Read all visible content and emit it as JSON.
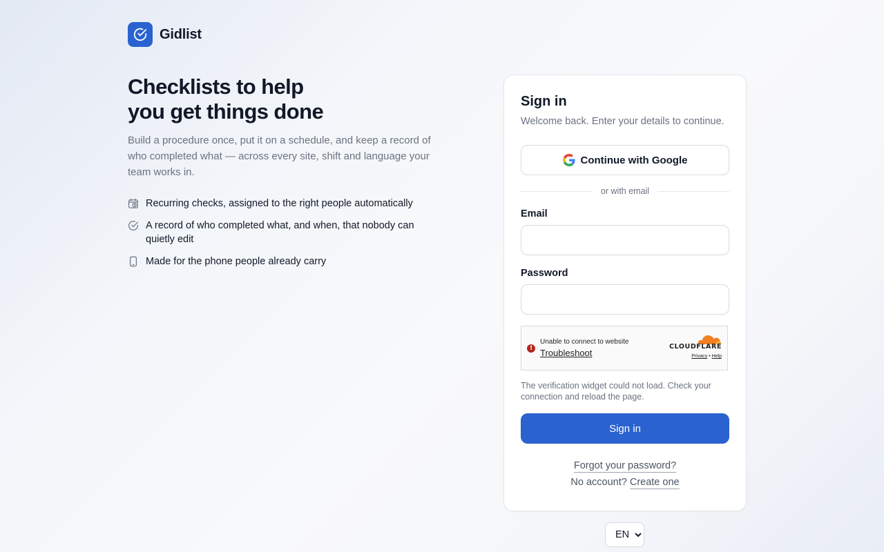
{
  "brand": {
    "name": "Gidlist",
    "logo_icon": "check-circle-icon"
  },
  "hero": {
    "title_line1": "Checklists to help",
    "title_line2": "you get things done",
    "lead": "Build a procedure once, put it on a schedule, and keep a record of who completed what — across every site, shift and language your team works in.",
    "features": [
      {
        "icon": "calendar-clock-icon",
        "text": "Recurring checks, assigned to the right people automatically"
      },
      {
        "icon": "check-circle-icon",
        "text": "A record of who completed what, and when, that nobody can quietly edit"
      },
      {
        "icon": "phone-icon",
        "text": "Made for the phone people already carry"
      }
    ]
  },
  "signin": {
    "title": "Sign in",
    "subtitle": "Welcome back. Enter your details to continue.",
    "google_label": "Continue with Google",
    "divider": "or with email",
    "email_label": "Email",
    "email_value": "",
    "password_label": "Password",
    "password_value": "",
    "captcha": {
      "message": "Unable to connect to website",
      "link": "Troubleshoot",
      "brand": "CLOUDFLARE",
      "privacy": "Privacy",
      "separator": "•",
      "help": "Help"
    },
    "verify_note": "The verification widget could not load. Check your connection and reload the page.",
    "submit_label": "Sign in",
    "forgot": "Forgot your password?",
    "no_account": "No account?",
    "create": "Create one"
  },
  "language": {
    "selected": "EN",
    "options": [
      "EN"
    ]
  },
  "colors": {
    "accent": "#2a62d0",
    "muted": "#6b7280",
    "error": "#b3261e",
    "cloudflare": "#f38020"
  }
}
